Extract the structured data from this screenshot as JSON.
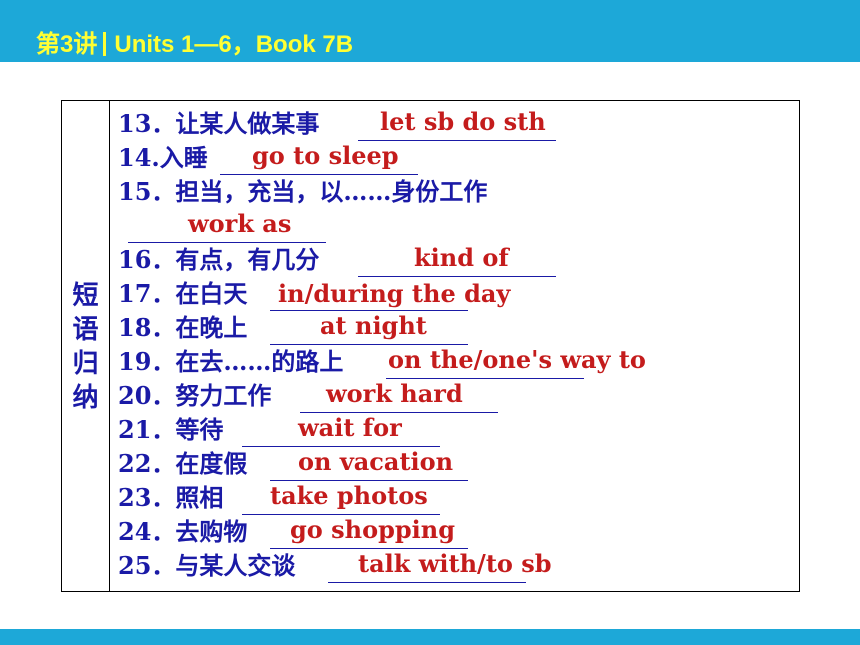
{
  "header": {
    "lesson": "第3讲",
    "topic": "Units 1—6，Book 7B"
  },
  "side_label": [
    "短",
    "语",
    "归",
    "纳"
  ],
  "phrases": [
    {
      "num": "13．",
      "cn": "让某人做某事",
      "answer": "let sb do sth"
    },
    {
      "num": "14.",
      "cn": "入睡",
      "answer": "go to sleep"
    },
    {
      "num": "15．",
      "cn": "担当，充当，以……身份工作",
      "answer": "work as"
    },
    {
      "num": "16．",
      "cn": "有点，有几分",
      "answer": "kind of"
    },
    {
      "num": "17．",
      "cn": "在白天",
      "answer": "in/during the day"
    },
    {
      "num": "18．",
      "cn": "在晚上",
      "answer": "at night"
    },
    {
      "num": "19．",
      "cn": "在去……的路上",
      "answer": "on the/one's way to"
    },
    {
      "num": "20．",
      "cn": "努力工作",
      "answer": "work hard"
    },
    {
      "num": "21．",
      "cn": "等待",
      "answer": "wait for"
    },
    {
      "num": "22．",
      "cn": "在度假",
      "answer": "on vacation"
    },
    {
      "num": "23．",
      "cn": "照相",
      "answer": "take photos"
    },
    {
      "num": "24．",
      "cn": "去购物",
      "answer": "go shopping"
    },
    {
      "num": "25．",
      "cn": "与某人交谈",
      "answer": "talk with/to sb"
    }
  ]
}
